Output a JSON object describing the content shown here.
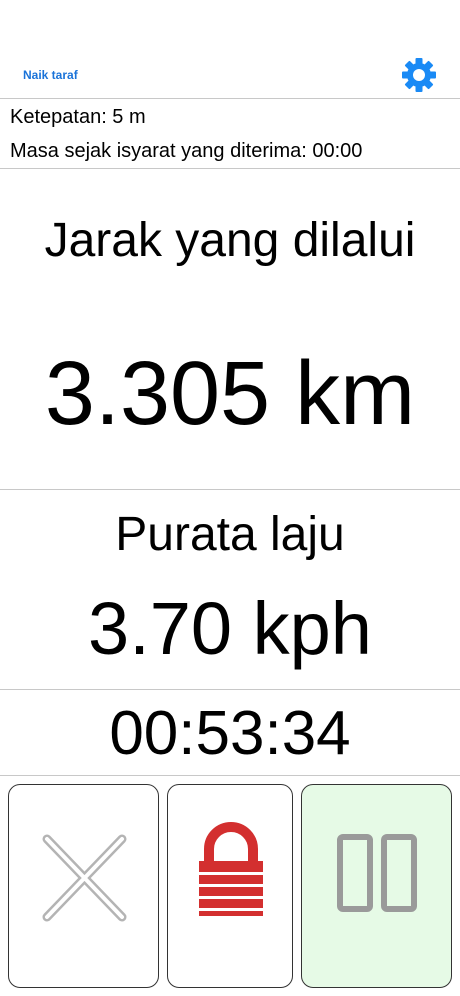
{
  "header": {
    "upgrade_label": "Naik taraf",
    "settings_icon": "gear-icon",
    "accent_color": "#1a8af5"
  },
  "status": {
    "accuracy_text": "Ketepatan: 5 m",
    "signal_time_text": "Masa sejak isyarat yang diterima: 00:00"
  },
  "distance": {
    "label": "Jarak yang dilalui",
    "value": "3.305 km"
  },
  "speed": {
    "label": "Purata laju",
    "value": "3.70 kph"
  },
  "timer": {
    "value": "00:53:34"
  },
  "controls": {
    "stop_icon": "close-icon",
    "lock_icon": "lock-icon",
    "pause_icon": "pause-icon",
    "lock_color": "#d32f2f",
    "pause_background": "#e6fae6"
  }
}
